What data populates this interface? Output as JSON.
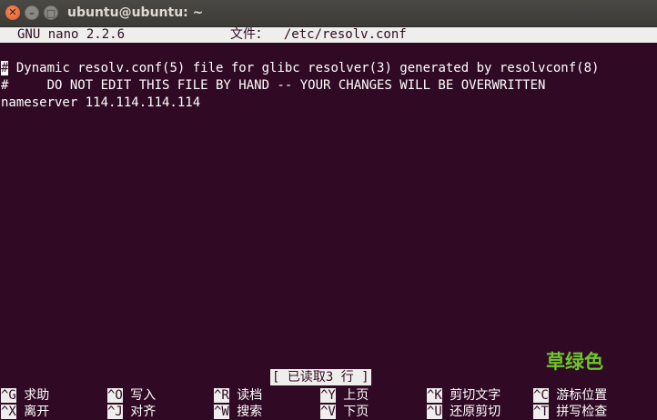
{
  "window": {
    "title": "ubuntu@ubuntu: ~",
    "close_glyph": "✕",
    "minimize_glyph": "–",
    "maximize_glyph": "□"
  },
  "nano": {
    "version": "GNU nano 2.2.6",
    "file_label": "文件：  /etc/resolv.conf"
  },
  "file_lines": [
    "# Dynamic resolv.conf(5) file for glibc resolver(3) generated by resolvconf(8)",
    "#     DO NOT EDIT THIS FILE BY HAND -- YOUR CHANGES WILL BE OVERWRITTEN",
    "nameserver 114.114.114.114"
  ],
  "status_message": "[ 已读取3 行 ]",
  "shortcuts_row1": [
    {
      "key": "^G",
      "label": "求助"
    },
    {
      "key": "^O",
      "label": "写入"
    },
    {
      "key": "^R",
      "label": "读档"
    },
    {
      "key": "^Y",
      "label": "上页"
    },
    {
      "key": "^K",
      "label": "剪切文字"
    },
    {
      "key": "^C",
      "label": "游标位置"
    }
  ],
  "shortcuts_row2": [
    {
      "key": "^X",
      "label": "离开"
    },
    {
      "key": "^J",
      "label": "对齐"
    },
    {
      "key": "^W",
      "label": "搜索"
    },
    {
      "key": "^V",
      "label": "下页"
    },
    {
      "key": "^U",
      "label": "还原剪切"
    },
    {
      "key": "^T",
      "label": "拼写检查"
    }
  ],
  "watermark_overlay": "草绿色",
  "colors": {
    "terminal_bg": "#300a24",
    "inverse_bg": "#eeeeec",
    "overlay_green": "#6cc82a"
  }
}
